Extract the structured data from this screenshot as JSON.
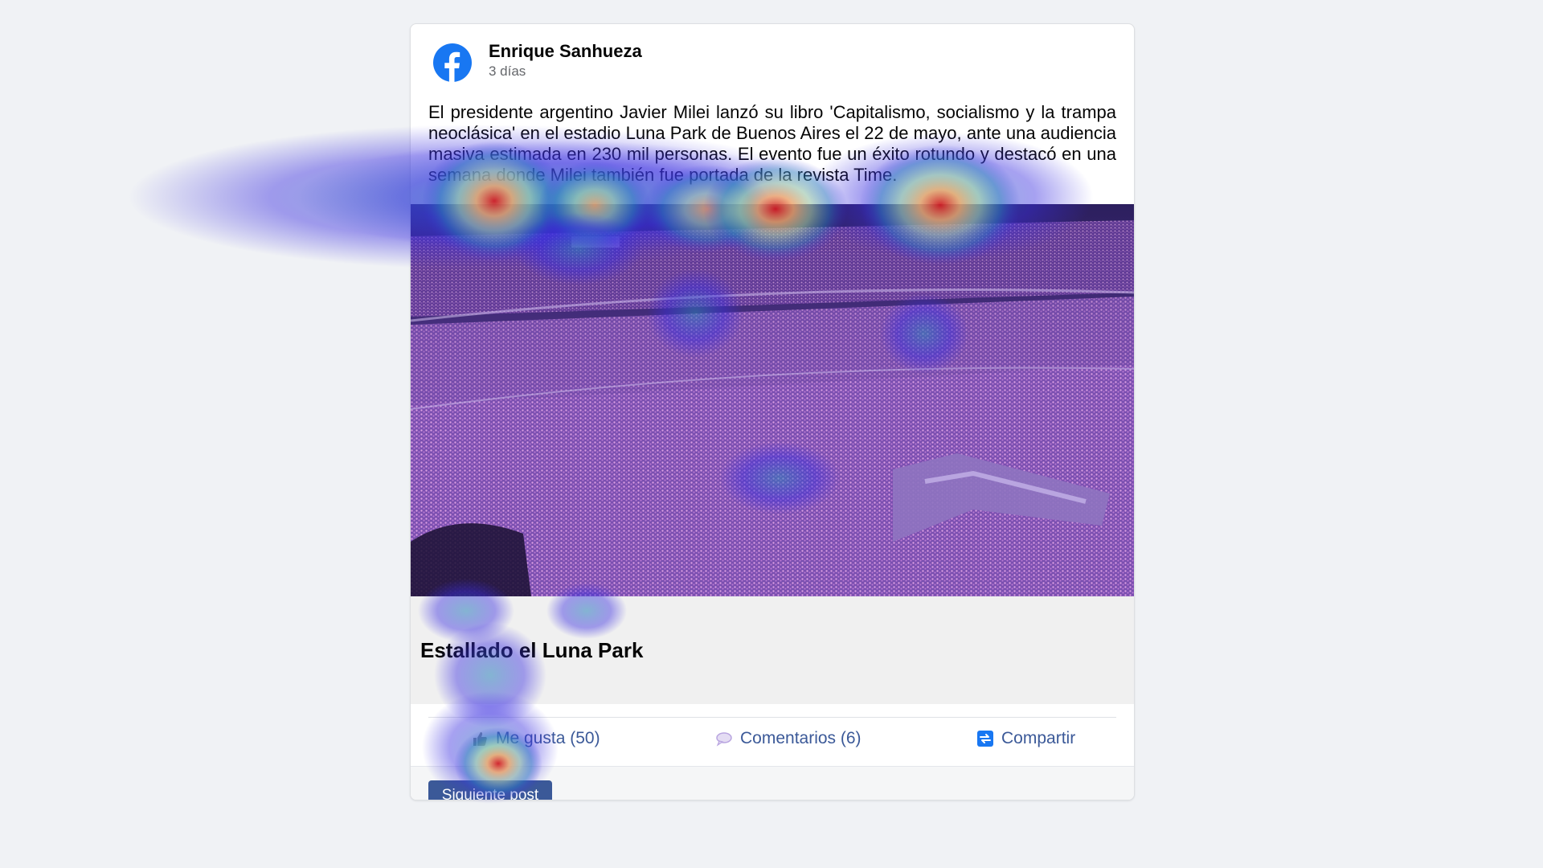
{
  "post": {
    "author": "Enrique Sanhueza",
    "time": "3 días",
    "text": "El presidente argentino Javier Milei lanzó su libro 'Capitalismo, socialismo y la trampa neoclásica' en el estadio Luna Park de Buenos Aires el 22 de mayo, ante una audiencia masiva estimada en 230 mil personas. El evento fue un éxito rotundo y destacó en una semana donde Milei también fue portada de la revista Time.",
    "image_icon": "stadium-crowd-photo",
    "link_title": "Estallado el Luna Park"
  },
  "actions": {
    "like_label": "Me gusta (50)",
    "like_icon": "thumbs-up-icon",
    "comment_label": "Comentarios (6)",
    "comment_icon": "speech-bubble-icon",
    "share_label": "Compartir",
    "share_icon": "share-arrows-icon"
  },
  "footer": {
    "next_label": "Siguiente post"
  },
  "colors": {
    "brand": "#1877f2",
    "action": "#3b5998",
    "background": "#f0f2f5"
  }
}
